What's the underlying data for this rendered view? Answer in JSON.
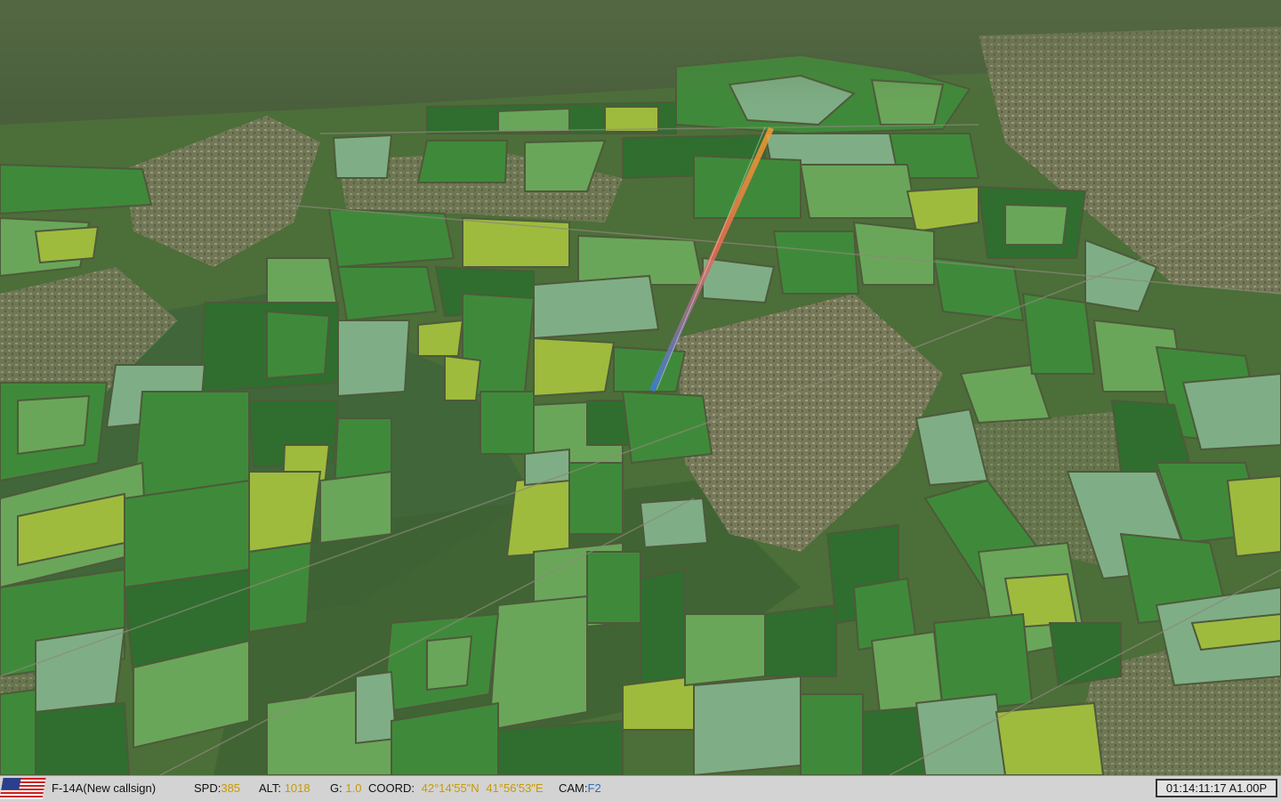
{
  "scene": {
    "view": "aerial-terrain",
    "colors": {
      "field_dark": "#2f6e2e",
      "field_mid": "#3f8a3a",
      "field_light": "#6aa65a",
      "field_pale": "#7fae86",
      "field_yellow": "#9fbb3e",
      "town": "#7d7c5f",
      "forest": "#3e5f32",
      "trail_start": "#f0a030",
      "trail_end": "#3a7be0"
    }
  },
  "status_bar": {
    "flag_icon": "us-flag-icon",
    "callsign": "F-14A(New callsign)",
    "speed_label": "SPD:",
    "speed_value": "385",
    "altitude_label": "ALT:",
    "altitude_value": "1018",
    "g_label": "G:",
    "g_value": "1.0",
    "coord_label": "COORD:",
    "coord_lat": "42°14'55\"N",
    "coord_lon": "41°56'53\"E",
    "cam_label": "CAM:",
    "cam_value": "F2",
    "clock": "01:14:11:17 A1.00P"
  }
}
